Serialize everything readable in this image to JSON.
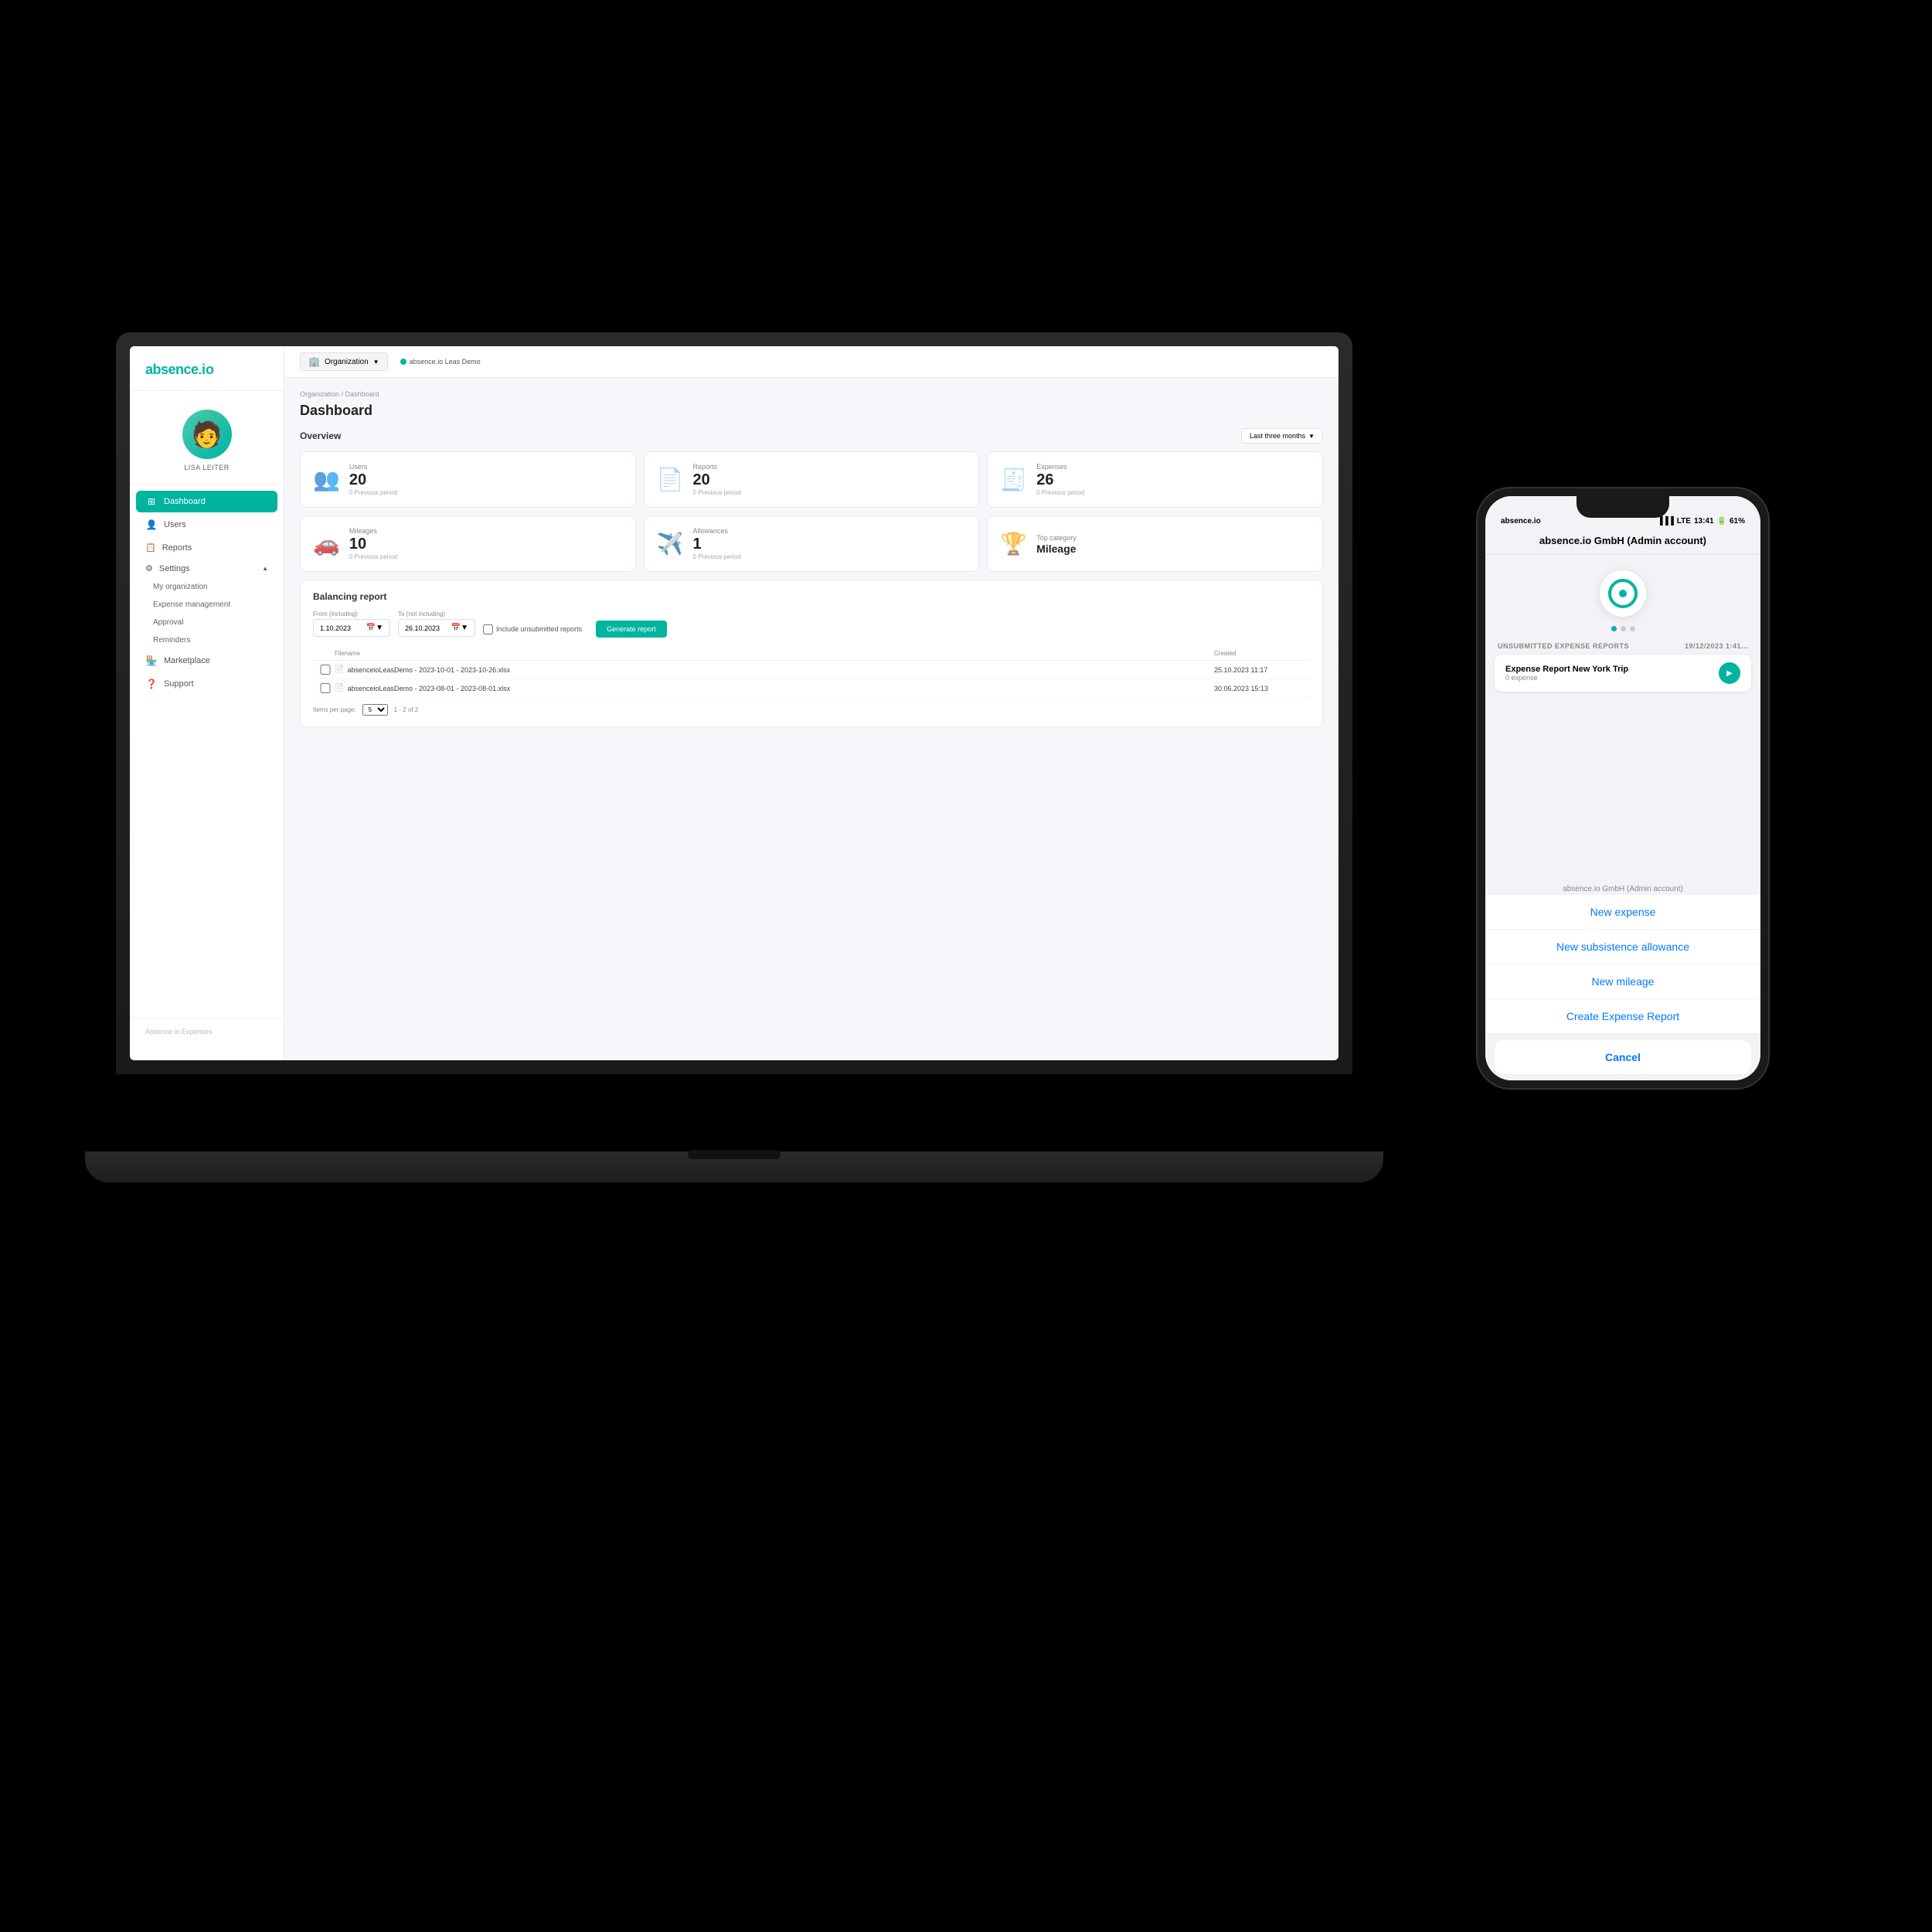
{
  "app": {
    "name": "absence.io",
    "logo_text": "absence",
    "logo_suffix": "io"
  },
  "sidebar": {
    "user_name": "LISA LEITER",
    "nav_items": [
      {
        "id": "dashboard",
        "label": "Dashboard",
        "icon": "⊞",
        "active": true
      },
      {
        "id": "users",
        "label": "Users",
        "icon": "👤",
        "active": false
      },
      {
        "id": "reports",
        "label": "Reports",
        "icon": "📋",
        "active": false
      },
      {
        "id": "settings",
        "label": "Settings",
        "icon": "⚙",
        "active": false
      }
    ],
    "settings_sub": [
      {
        "id": "my-org",
        "label": "My organization"
      },
      {
        "id": "expense-mgmt",
        "label": "Expense management"
      },
      {
        "id": "approval",
        "label": "Approval"
      },
      {
        "id": "reminders",
        "label": "Reminders"
      }
    ],
    "marketplace": "Marketplace",
    "support": "Support",
    "footer": "Absence.io Expenses"
  },
  "topbar": {
    "org_label": "Organization",
    "connected_text": "absence.io Leas Demo"
  },
  "dashboard": {
    "breadcrumb": "Organization / Dashboard",
    "title": "Dashboard",
    "overview_label": "Overview",
    "period_label": "Last three months",
    "stats": [
      {
        "id": "users",
        "label": "Users",
        "value": "20",
        "prev": "0 Previous period"
      },
      {
        "id": "reports",
        "label": "Reports",
        "value": "20",
        "prev": "0 Previous period"
      },
      {
        "id": "expenses",
        "label": "Expenses",
        "value": "26",
        "prev": "0 Previous period"
      },
      {
        "id": "mileages",
        "label": "Mileages",
        "value": "10",
        "prev": "0 Previous period"
      },
      {
        "id": "allowances",
        "label": "Allowances",
        "value": "1",
        "prev": "0 Previous period"
      },
      {
        "id": "top-category",
        "label": "Top category",
        "value": "Mileage",
        "prev": ""
      }
    ],
    "balancing": {
      "title": "Balancing report",
      "from_label": "From (including)",
      "to_label": "To (not including)",
      "from_value": "1.10.2023",
      "to_value": "26.10.2023",
      "checkbox_label": "Include unsubmitted reports",
      "generate_btn": "Generate report",
      "table": {
        "filename_col": "Filename",
        "created_col": "Created",
        "rows": [
          {
            "filename": "absenceioLeasDemo - 2023-10-01 - 2023-10-26.xlsx",
            "created": "25.10.2023 11:17"
          },
          {
            "filename": "absenceioLeasDemo - 2023-08-01 - 2023-08-01.xlsx",
            "created": "30.06.2023 15:13"
          }
        ]
      },
      "pagination": "1 - 2 of 2",
      "items_per_page": "5"
    }
  },
  "phone": {
    "carrier": "absence.io",
    "signal": "LTE",
    "time": "13:41",
    "battery": "61%",
    "app_title": "absence.io GmbH (Admin account)",
    "company_label": "absence.io GmbH (Admin account)",
    "unsubmitted_label": "UNSUBMITTED EXPENSE REPORTS",
    "report_date": "19/12/2023 1:41...",
    "report_title": "Expense Report New York Trip",
    "report_sub": "0 expense",
    "actions": [
      {
        "id": "new-expense",
        "label": "New expense"
      },
      {
        "id": "new-subsistence",
        "label": "New subsistence allowance"
      },
      {
        "id": "new-mileage",
        "label": "New mileage"
      },
      {
        "id": "create-report",
        "label": "Create Expense Report"
      }
    ],
    "cancel_label": "Cancel"
  }
}
